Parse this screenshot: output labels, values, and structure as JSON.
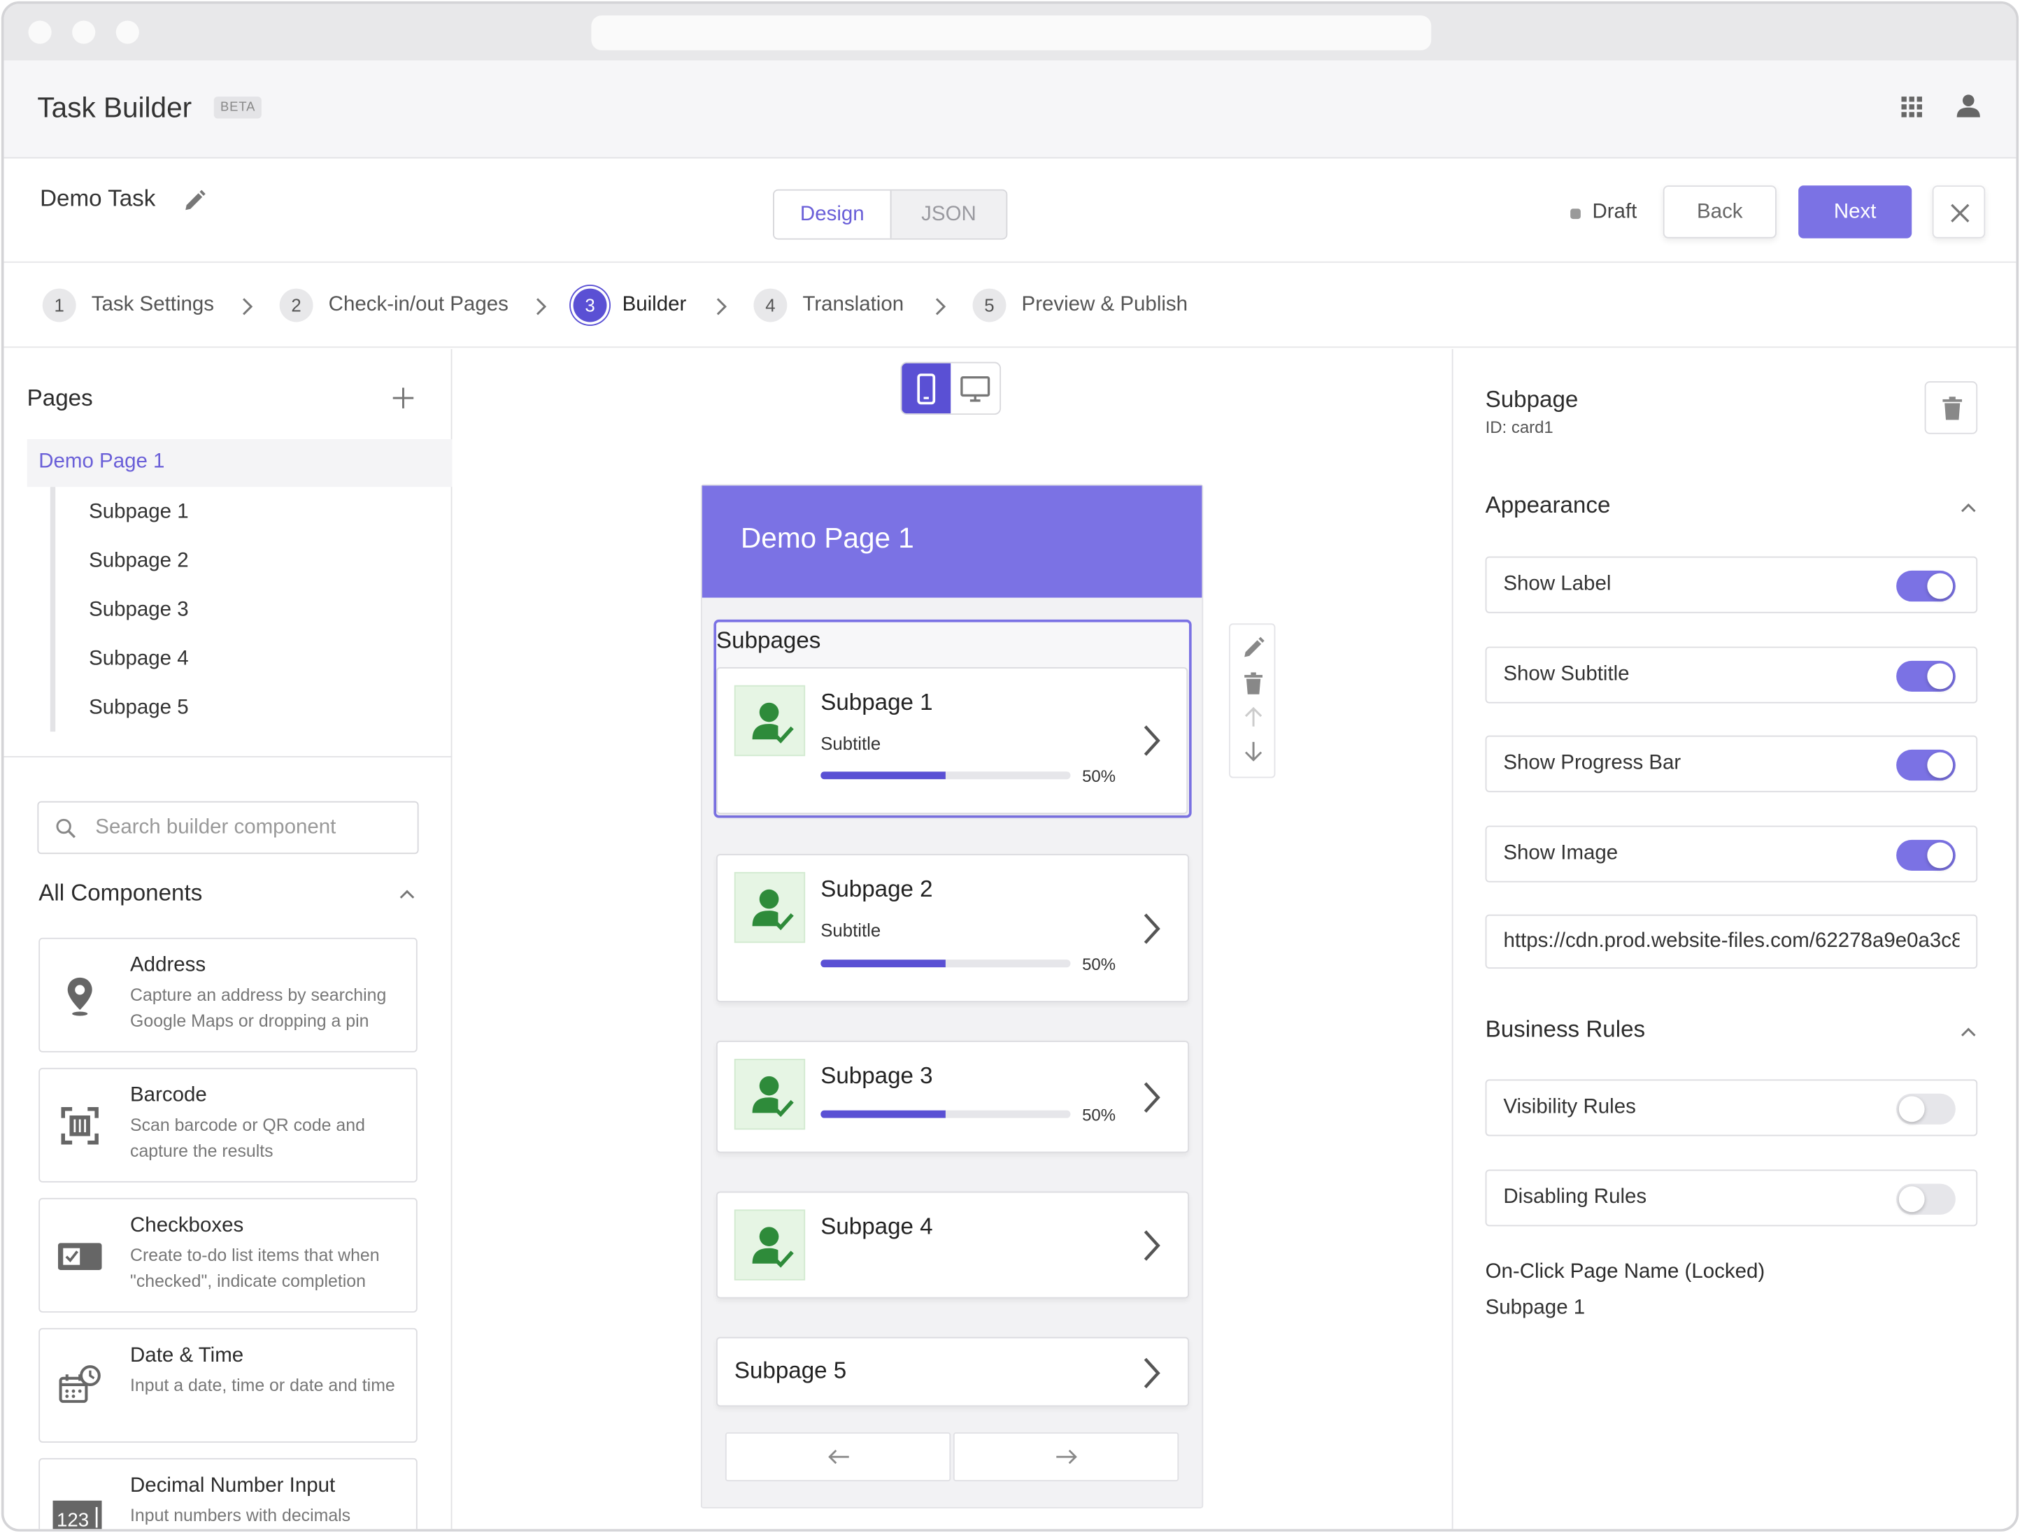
{
  "app": {
    "title": "Task Builder",
    "badge": "BETA",
    "apps_icon": "grid-icon",
    "user_icon": "user-icon"
  },
  "task": {
    "name": "Demo Task",
    "status": "Draft",
    "status_color": "#999999"
  },
  "mode_tabs": {
    "design": "Design",
    "json": "JSON",
    "active": "Design"
  },
  "actions": {
    "back": "Back",
    "next": "Next"
  },
  "steps": [
    {
      "num": "1",
      "label": "Task Settings"
    },
    {
      "num": "2",
      "label": "Check-in/out Pages"
    },
    {
      "num": "3",
      "label": "Builder"
    },
    {
      "num": "4",
      "label": "Translation"
    },
    {
      "num": "5",
      "label": "Preview & Publish"
    }
  ],
  "active_step": "3",
  "pages_panel": {
    "title": "Pages",
    "page": "Demo Page 1",
    "subpages": [
      "Subpage 1",
      "Subpage 2",
      "Subpage 3",
      "Subpage 4",
      "Subpage 5"
    ]
  },
  "components": {
    "search_placeholder": "Search builder component",
    "section_title": "All Components",
    "items": [
      {
        "name": "Address",
        "desc": "Capture an address by searching Google Maps or dropping a pin",
        "icon": "map-pin-icon"
      },
      {
        "name": "Barcode",
        "desc": "Scan barcode or QR code and capture the results",
        "icon": "barcode-scan-icon"
      },
      {
        "name": "Checkboxes",
        "desc": "Create to-do list items that when \"checked\", indicate completion",
        "icon": "checkbox-icon"
      },
      {
        "name": "Date & Time",
        "desc": "Input a date, time or date and time",
        "icon": "calendar-clock-icon"
      },
      {
        "name": "Decimal Number Input",
        "desc": "Input numbers with decimals",
        "icon": "number-input-icon",
        "icon_text": "123"
      }
    ]
  },
  "preview": {
    "device": "mobile",
    "page_title": "Demo Page 1",
    "subpages_label": "Subpages",
    "cards": [
      {
        "title": "Subpage 1",
        "subtitle": "Subtitle",
        "progress": 0.5,
        "progress_label": "50%"
      },
      {
        "title": "Subpage 2",
        "subtitle": "Subtitle",
        "progress": 0.5,
        "progress_label": "50%"
      },
      {
        "title": "Subpage 3",
        "progress": 0.5,
        "progress_label": "50%"
      },
      {
        "title": "Subpage 4"
      },
      {
        "title": "Subpage 5"
      }
    ]
  },
  "properties": {
    "title": "Subpage",
    "id_label": "ID: card1",
    "appearance_title": "Appearance",
    "toggles": [
      {
        "label": "Show Label",
        "on": true
      },
      {
        "label": "Show Subtitle",
        "on": true
      },
      {
        "label": "Show Progress Bar",
        "on": true
      },
      {
        "label": "Show Image",
        "on": true
      }
    ],
    "image_url": "https://cdn.prod.website-files.com/62278a9e0a3c8",
    "business_rules_title": "Business Rules",
    "rules": [
      {
        "label": "Visibility Rules",
        "on": false
      },
      {
        "label": "Disabling Rules",
        "on": false
      }
    ],
    "onclick_label": "On-Click Page Name (Locked)",
    "onclick_value": "Subpage 1"
  },
  "colors": {
    "accent": "#7b72e4",
    "accent_dark": "#5a50d4",
    "success_icon": "#2e8b3a"
  }
}
